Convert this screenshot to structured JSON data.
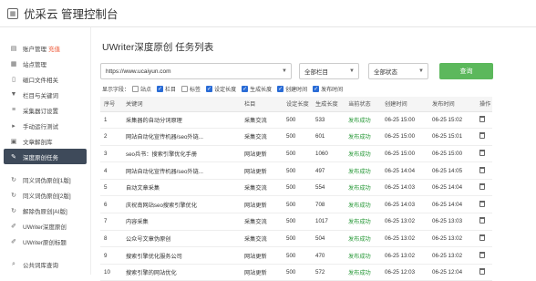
{
  "app": {
    "title": "优采云 管理控制台"
  },
  "sidebar": {
    "items": [
      {
        "label": "账户管理",
        "badge": "充值",
        "icon": "chart-icon"
      },
      {
        "label": "站点管理",
        "icon": "grid-icon"
      },
      {
        "label": "磁口文件相关",
        "icon": "document-icon"
      },
      {
        "label": "栏目与关键词",
        "icon": "filter-icon"
      },
      {
        "label": "采集器订设置",
        "icon": "list-icon"
      },
      {
        "label": "手动运行测试",
        "icon": "play-icon"
      },
      {
        "label": "文章解剖库",
        "icon": "book-icon"
      },
      {
        "label": "深度原创任务",
        "icon": "edit-icon",
        "active": true
      },
      {
        "label": "同义词伪原创[1版]",
        "icon": "refresh-icon"
      },
      {
        "label": "同义词伪原创[2版]",
        "icon": "refresh-icon"
      },
      {
        "label": "解除伪原创[AI版]",
        "icon": "refresh-icon"
      },
      {
        "label": "UWriter深度原创",
        "icon": "pen-icon"
      },
      {
        "label": "UWriter原创标题",
        "icon": "pen-icon"
      },
      {
        "label": "公共词库查询",
        "icon": "search-icon"
      }
    ]
  },
  "main": {
    "title": "UWriter深度原创 任务列表",
    "filters": {
      "site": "https://www.ucaiyun.com",
      "column": "全部栏目",
      "status": "全部状态",
      "query_label": "查询"
    },
    "fields_label": "显示字段：",
    "fields": [
      {
        "label": "站点",
        "checked": false
      },
      {
        "label": "栏目",
        "checked": true
      },
      {
        "label": "标签",
        "checked": false
      },
      {
        "label": "设定长度",
        "checked": true
      },
      {
        "label": "生成长度",
        "checked": true
      },
      {
        "label": "创建时间",
        "checked": true
      },
      {
        "label": "发布时间",
        "checked": true
      }
    ],
    "columns": [
      "序号",
      "关键词",
      "栏目",
      "设定长度",
      "生成长度",
      "当前状态",
      "创建时间",
      "发布时间",
      "操作"
    ],
    "rows": [
      [
        "1",
        "采集器的自动分词原理",
        "采集交流",
        "500",
        "533",
        "发布成功",
        "06-25 15:00",
        "06-25 15:02"
      ],
      [
        "2",
        "网站自动化宣传机器/seo外链...",
        "采集交流",
        "500",
        "601",
        "发布成功",
        "06-25 15:00",
        "06-25 15:01"
      ],
      [
        "3",
        "seo兵书：搜索引擎优化手册",
        "网站更新",
        "500",
        "1060",
        "发布成功",
        "06-25 15:00",
        "06-25 15:00"
      ],
      [
        "4",
        "网站自动化宣传机器/seo外链...",
        "网站更新",
        "500",
        "497",
        "发布成功",
        "06-25 14:04",
        "06-25 14:05"
      ],
      [
        "5",
        "自动文章采集",
        "采集交流",
        "500",
        "554",
        "发布成功",
        "06-25 14:03",
        "06-25 14:04"
      ],
      [
        "6",
        "庆祝南网站seo搜索引擎优化",
        "网站更新",
        "500",
        "708",
        "发布成功",
        "06-25 14:03",
        "06-25 14:04"
      ],
      [
        "7",
        "内容采集",
        "采集交流",
        "500",
        "1017",
        "发布成功",
        "06-25 13:02",
        "06-25 13:03"
      ],
      [
        "8",
        "公众号文章伪原创",
        "采集交流",
        "500",
        "504",
        "发布成功",
        "06-25 13:02",
        "06-25 13:02"
      ],
      [
        "9",
        "搜索引擎优化服务公司",
        "网站更新",
        "500",
        "470",
        "发布成功",
        "06-25 13:02",
        "06-25 13:02"
      ],
      [
        "10",
        "搜索引擎的网站优化",
        "网站更新",
        "500",
        "572",
        "发布成功",
        "06-25 12:03",
        "06-25 12:04"
      ]
    ]
  }
}
